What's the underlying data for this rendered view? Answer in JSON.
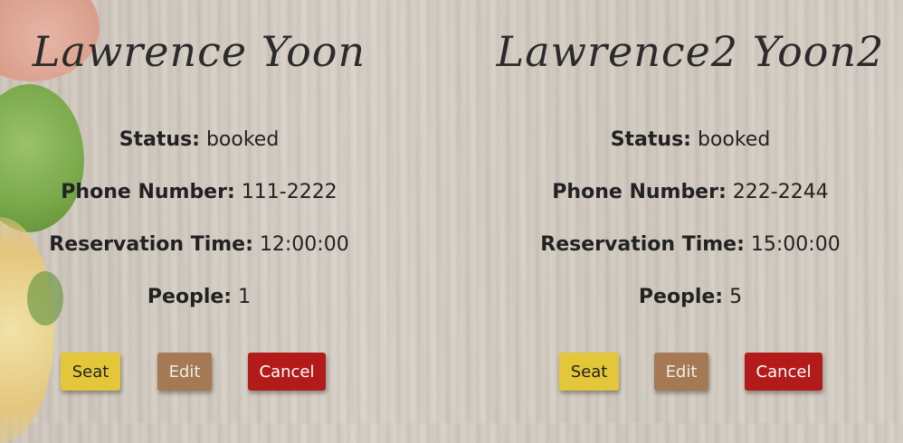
{
  "reservations": [
    {
      "name": "Lawrence Yoon",
      "status_label": "Status:",
      "status": "booked",
      "phone_label": "Phone Number:",
      "phone": "111-2222",
      "time_label": "Reservation Time:",
      "time": "12:00:00",
      "people_label": "People:",
      "people": "1",
      "seat_label": "Seat",
      "edit_label": "Edit",
      "cancel_label": "Cancel"
    },
    {
      "name": "Lawrence2 Yoon2",
      "status_label": "Status:",
      "status": "booked",
      "phone_label": "Phone Number:",
      "phone": "222-2244",
      "time_label": "Reservation Time:",
      "time": "15:00:00",
      "people_label": "People:",
      "people": "5",
      "seat_label": "Seat",
      "edit_label": "Edit",
      "cancel_label": "Cancel"
    }
  ],
  "colors": {
    "seat": "#e4c63a",
    "edit": "#a47953",
    "cancel": "#b31b1b"
  }
}
